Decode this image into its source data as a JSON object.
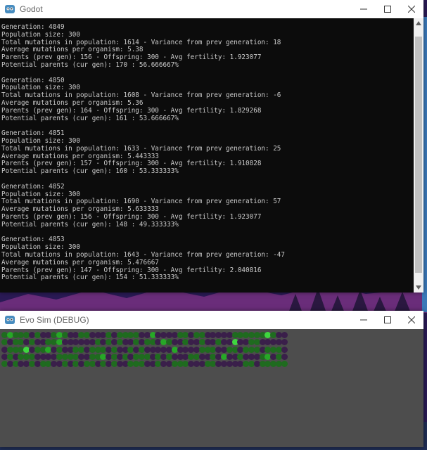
{
  "console_window": {
    "title": "Godot",
    "lines": [
      "Generation: 4849",
      "Population size: 300",
      "Total mutations in population: 1614 - Variance from prev generation: 18",
      "Average mutations per organism: 5.38",
      "Parents (prev gen): 156 - Offspring: 300 - Avg fertility: 1.923077",
      "Potential parents (cur gen): 170 : 56.666667%",
      "",
      "Generation: 4850",
      "Population size: 300",
      "Total mutations in population: 1608 - Variance from prev generation: -6",
      "Average mutations per organism: 5.36",
      "Parents (prev gen): 164 - Offspring: 300 - Avg fertility: 1.829268",
      "Potential parents (cur gen): 161 : 53.666667%",
      "",
      "Generation: 4851",
      "Population size: 300",
      "Total mutations in population: 1633 - Variance from prev generation: 25",
      "Average mutations per organism: 5.443333",
      "Parents (prev gen): 157 - Offspring: 300 - Avg fertility: 1.910828",
      "Potential parents (cur gen): 160 : 53.333333%",
      "",
      "Generation: 4852",
      "Population size: 300",
      "Total mutations in population: 1690 - Variance from prev generation: 57",
      "Average mutations per organism: 5.633333",
      "Parents (prev gen): 156 - Offspring: 300 - Avg fertility: 1.923077",
      "Potential parents (cur gen): 148 : 49.333333%",
      "",
      "Generation: 4853",
      "Population size: 300",
      "Total mutations in population: 1643 - Variance from prev generation: -47",
      "Average mutations per organism: 5.476667",
      "Parents (prev gen): 147 - Offspring: 300 - Avg fertility: 2.040816",
      "Potential parents (cur gen): 154 : 51.333333%"
    ]
  },
  "sim_window": {
    "title": "Evo Sim (DEBUG)",
    "colors": {
      "background": "#4d4d4d",
      "organism_dark": "#3a1f4a",
      "organism_green_dark": "#1f6b1f",
      "organism_green": "#27a827",
      "organism_green_bright": "#3fd63f"
    },
    "grid_rows": [
      "1211101001210011000101111002000011011000001111113100",
      "1011010011200000010101001011021001001001003001100000",
      "0111301120100110111010010100000200001110011011101110",
      "0101110000111100112010101110101000110010200100012010",
      "1010010110010101101010011100100111000110000011011111"
    ]
  }
}
